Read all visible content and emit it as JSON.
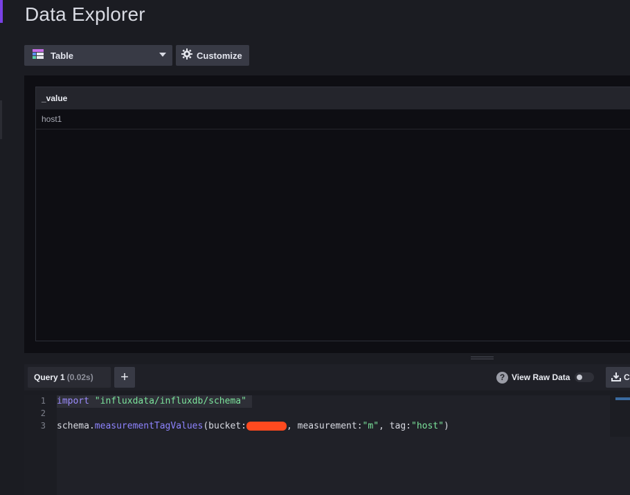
{
  "page": {
    "title": "Data Explorer"
  },
  "toolbar": {
    "visualization_label": "Table",
    "customize_label": "Customize"
  },
  "table": {
    "columns": [
      "_value"
    ],
    "rows": [
      [
        "host1"
      ]
    ]
  },
  "query_bar": {
    "tab_label": "Query 1",
    "tab_time": "(0.02s)",
    "add_label": "+",
    "raw_data_label": "View Raw Data",
    "help_glyph": "?",
    "csv_label": "C"
  },
  "editor": {
    "line_numbers": [
      "1",
      "2",
      "3"
    ],
    "line1": {
      "keyword": "import",
      "space": " ",
      "string": "\"influxdata/influxdb/schema\""
    },
    "line3": {
      "obj": "schema.",
      "func": "measurementTagValues",
      "open": "(bucket:",
      "mid": ", measurement:",
      "m_val": "\"m\"",
      "tag_key": ", tag:",
      "tag_val": "\"host\"",
      "close": ")"
    }
  },
  "colors": {
    "accent": "#7a41e6",
    "redaction": "#ff4a1f",
    "string": "#7ce49c",
    "keyword": "#9c8cff"
  },
  "icons": {
    "visualization": "table-icon",
    "customize": "gear-icon",
    "help": "question-circle-icon",
    "download": "download-icon"
  }
}
